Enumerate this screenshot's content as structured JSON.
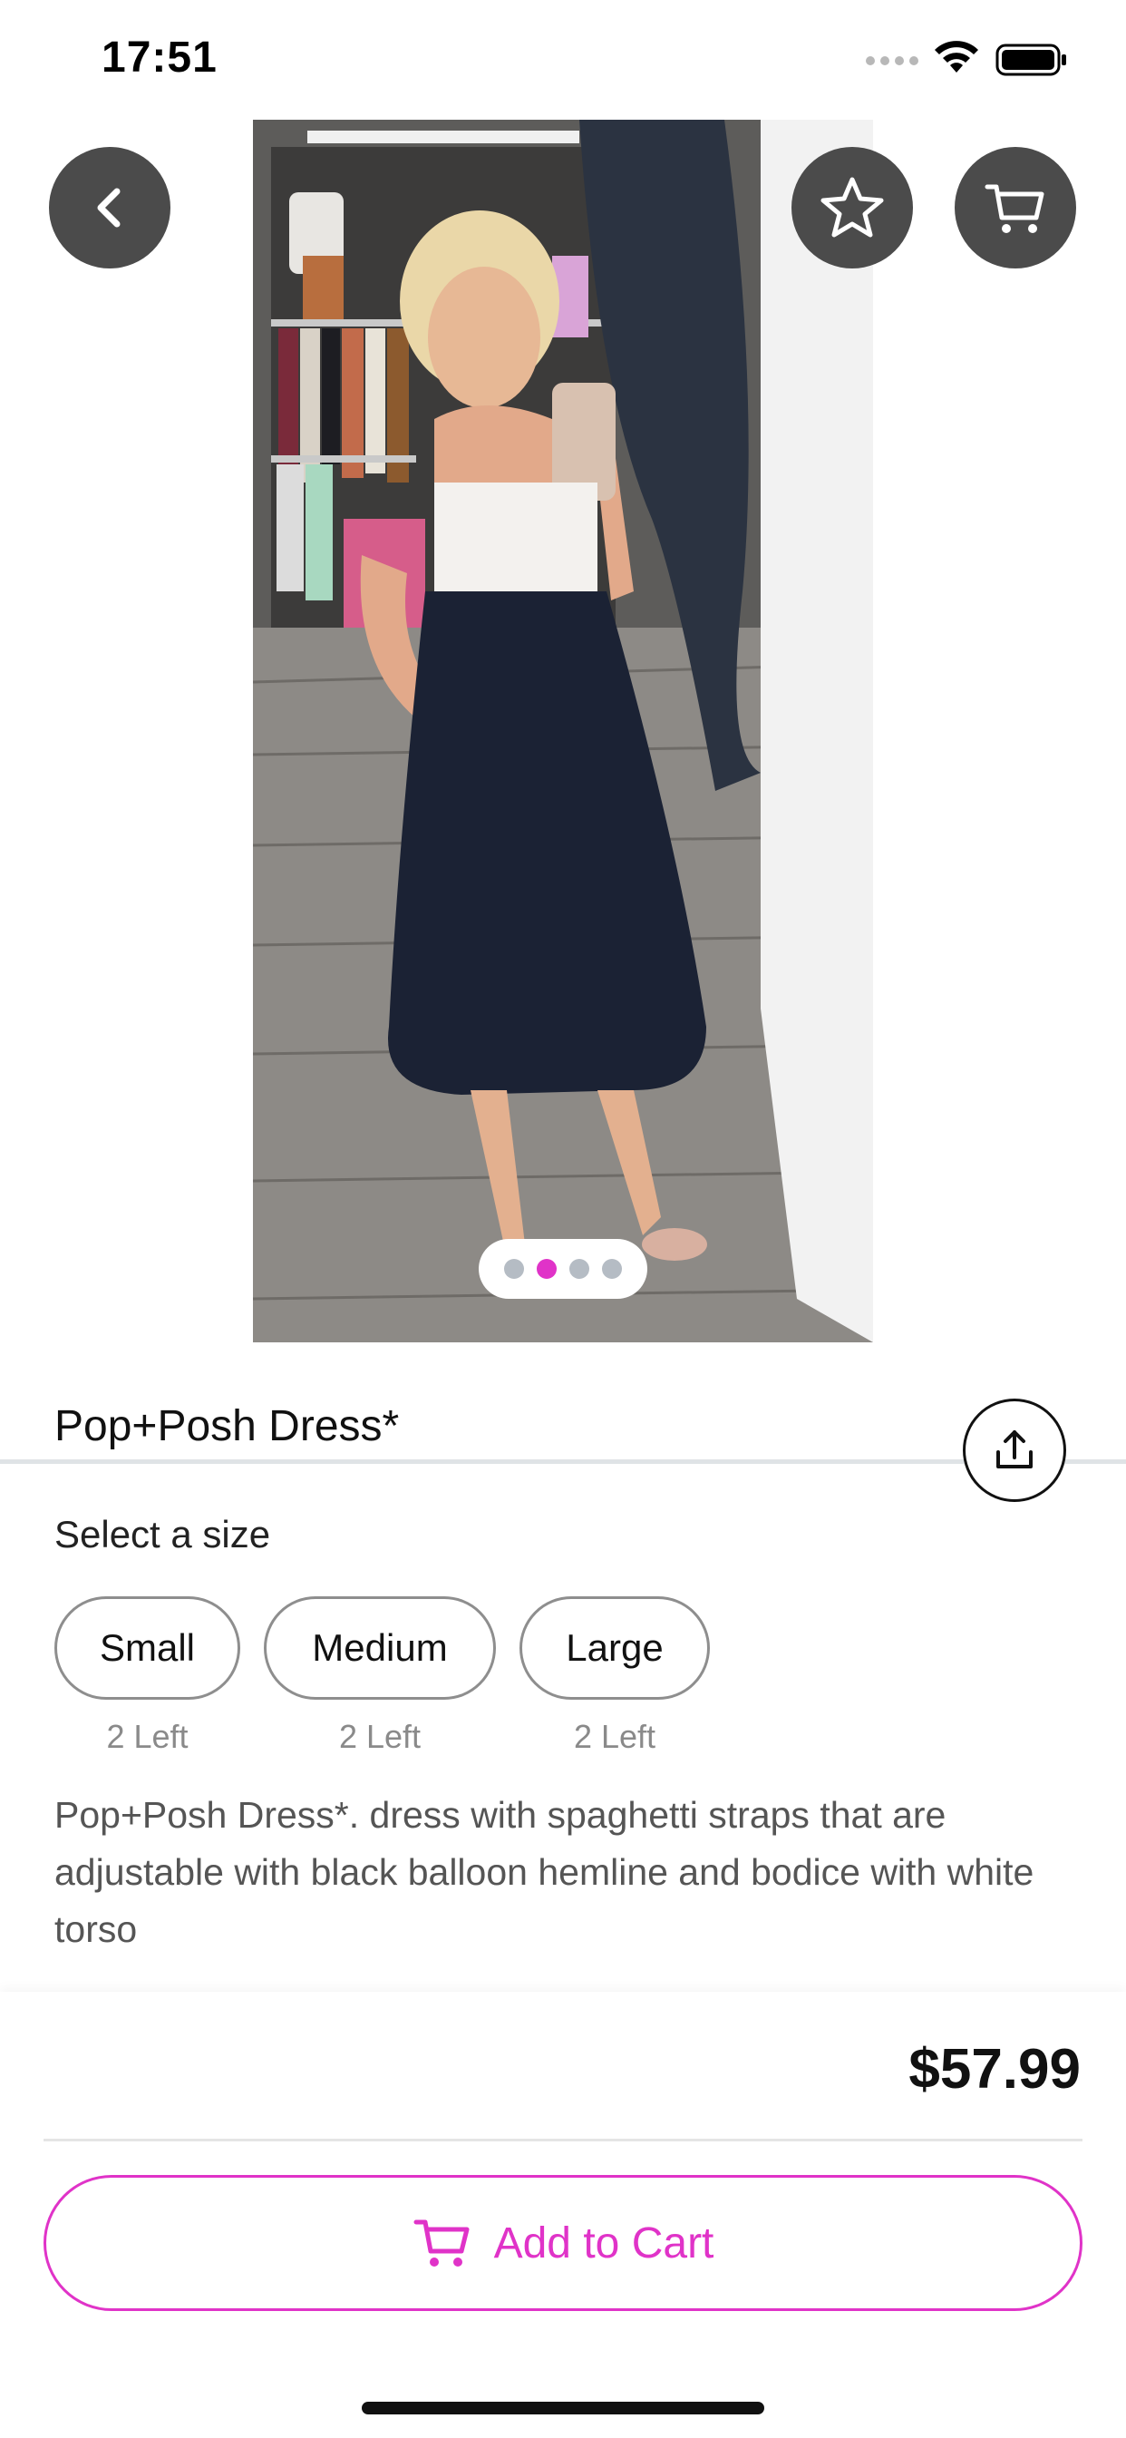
{
  "status_bar": {
    "time": "17:51"
  },
  "gallery": {
    "image_count": 4,
    "active_index": 1
  },
  "product": {
    "title": "Pop+Posh  Dress*",
    "select_size_label": "Select a size",
    "sizes": [
      {
        "label": "Small",
        "stock": "2 Left"
      },
      {
        "label": "Medium",
        "stock": "2 Left"
      },
      {
        "label": "Large",
        "stock": "2 Left"
      }
    ],
    "description": "Pop+Posh  Dress*. dress with spaghetti straps that are adjustable with black balloon hemline and bodice with white torso",
    "price": "$57.99"
  },
  "actions": {
    "add_to_cart_label": "Add to Cart"
  },
  "icons": {
    "back": "chevron-left-icon",
    "favorite": "star-icon",
    "cart": "cart-icon",
    "share": "share-icon"
  },
  "colors": {
    "accent": "#e033c8",
    "button_bg": "#4b4b4b",
    "pager_inactive": "#b5bcc4"
  }
}
